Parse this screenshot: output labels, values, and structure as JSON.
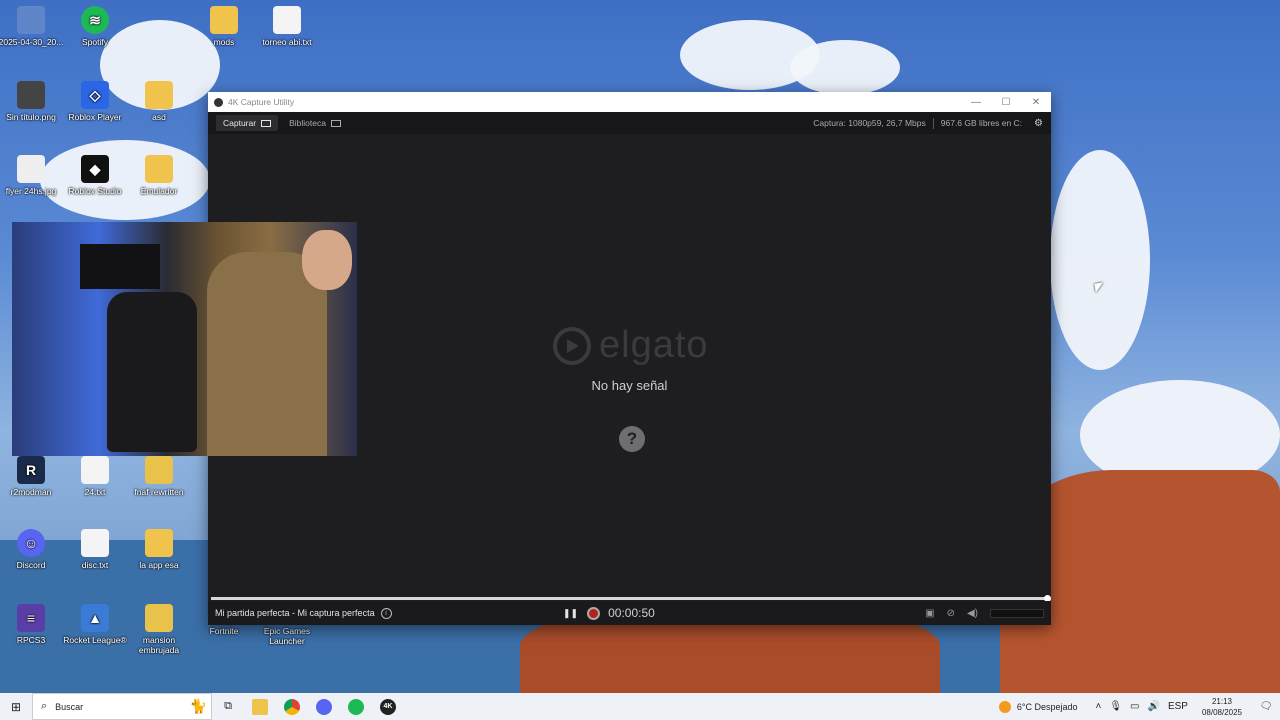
{
  "desktop": {
    "icons": [
      {
        "label": "2025-04-30_20...",
        "icon": "image-icon"
      },
      {
        "label": "Spotify",
        "icon": "spotify-icon"
      },
      {
        "label": "mods",
        "icon": "folder-icon"
      },
      {
        "label": "torneo abi.txt",
        "icon": "text-file-icon"
      },
      {
        "label": "Sin título.png",
        "icon": "image-icon"
      },
      {
        "label": "Roblox Player",
        "icon": "roblox-icon"
      },
      {
        "label": "asd",
        "icon": "folder-icon"
      },
      {
        "label": "flyer 24hs.jpg",
        "icon": "image-icon"
      },
      {
        "label": "Roblox Studio",
        "icon": "roblox-studio-icon"
      },
      {
        "label": "Emulador",
        "icon": "folder-icon"
      },
      {
        "label": "r2modman",
        "icon": "r2modman-icon"
      },
      {
        "label": "24.txt",
        "icon": "text-file-icon"
      },
      {
        "label": "fnaf rewritten",
        "icon": "shortcut-icon"
      },
      {
        "label": "Discord",
        "icon": "discord-icon"
      },
      {
        "label": "disc.txt",
        "icon": "text-file-icon"
      },
      {
        "label": "la app esa",
        "icon": "folder-icon"
      },
      {
        "label": "RPCS3",
        "icon": "rpcs3-icon"
      },
      {
        "label": "Rocket League®",
        "icon": "rocket-league-icon"
      },
      {
        "label": "mansion embrujada",
        "icon": "shortcut-icon"
      },
      {
        "label": "Fortnite",
        "icon": "fortnite-icon"
      },
      {
        "label": "Epic Games Launcher",
        "icon": "epic-games-icon"
      }
    ]
  },
  "window": {
    "title": "4K Capture Utility",
    "tabs": [
      {
        "label": "Capturar",
        "active": true
      },
      {
        "label": "Biblioteca",
        "active": false
      }
    ],
    "capture_info": "Captura: 1080p59, 26,7 Mbps",
    "disk_info": "967.6 GB libres en C:",
    "logo_text": "elgato",
    "no_signal": "No hay señal",
    "help_glyph": "?",
    "progress_fraction": 1.0,
    "recording_name": "Mi partida perfecta - Mi captura perfecta",
    "timer": "00:00:50",
    "info_glyph": "i"
  },
  "taskbar": {
    "search_placeholder": "Buscar",
    "weather": "6°C  Despejado",
    "language": "ESP",
    "time": "21:13",
    "date": "08/08/2025",
    "apps": [
      "task-view-icon",
      "file-explorer-icon",
      "chrome-icon",
      "discord-taskbar-icon",
      "spotify-taskbar-icon",
      "4k-capture-icon"
    ],
    "capture_app_label": "4K"
  }
}
